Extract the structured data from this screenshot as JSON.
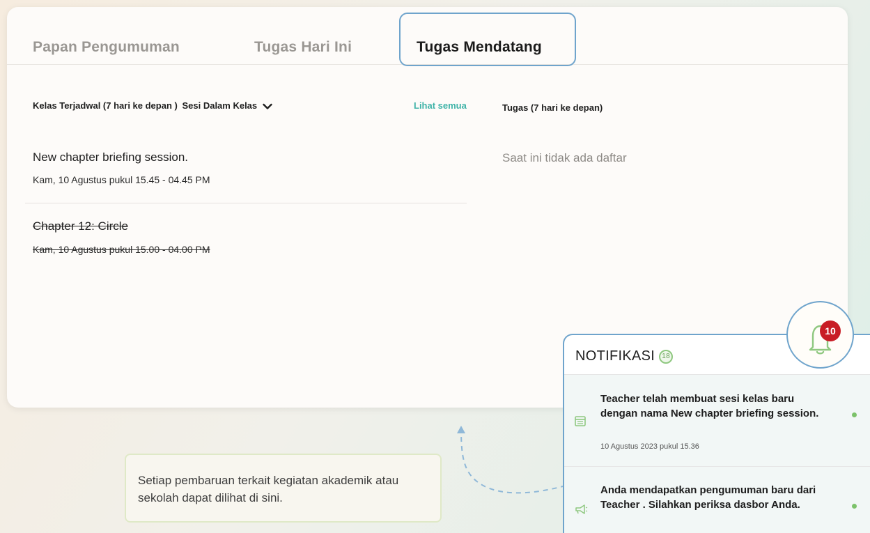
{
  "tabs": {
    "announcement": "Papan Pengumuman",
    "today": "Tugas Hari Ini",
    "upcoming": "Tugas Mendatang"
  },
  "schedule": {
    "header": "Kelas Terjadwal (7 hari ke depan )",
    "dropdown": "Sesi Dalam Kelas",
    "see_all": "Lihat semua",
    "items": [
      {
        "title": "New chapter briefing session.",
        "time": "Kam, 10 Agustus pukul 15.45 - 04.45 PM",
        "cancelled": false
      },
      {
        "title": "Chapter 12: Circle",
        "time": "Kam, 10 Agustus pukul 15.00 - 04.00 PM",
        "cancelled": true
      }
    ]
  },
  "tasks": {
    "header": "Tugas (7 hari ke depan)",
    "empty": "Saat ini tidak ada daftar"
  },
  "tooltip": {
    "text": "Setiap pembaruan terkait kegiatan akademik atau sekolah dapat dilihat di sini."
  },
  "notifications": {
    "title": "NOTIFIKASI",
    "count": "18",
    "bell_badge": "10",
    "items": [
      {
        "icon": "calendar-icon",
        "text": "Teacher telah membuat sesi kelas baru dengan nama New chapter briefing session.",
        "date": "10 Agustus 2023 pukul 15.36"
      },
      {
        "icon": "megaphone-icon",
        "text": "Anda mendapatkan pengumuman baru dari Teacher . Silahkan periksa dasbor Anda.",
        "date": ""
      }
    ]
  },
  "colors": {
    "accent_blue": "#6fa4cc",
    "link_teal": "#3fb3a8",
    "badge_red": "#c81d25",
    "unread_green": "#7cc26a"
  }
}
